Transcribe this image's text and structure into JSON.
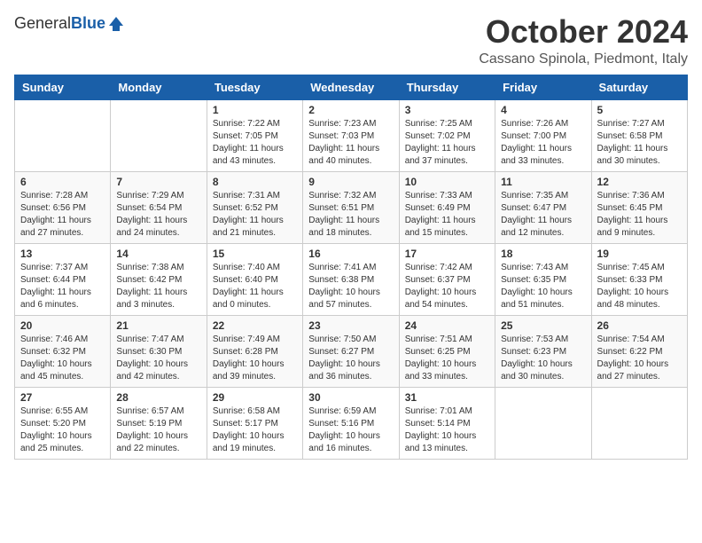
{
  "header": {
    "logo_general": "General",
    "logo_blue": "Blue",
    "month_title": "October 2024",
    "location": "Cassano Spinola, Piedmont, Italy"
  },
  "weekdays": [
    "Sunday",
    "Monday",
    "Tuesday",
    "Wednesday",
    "Thursday",
    "Friday",
    "Saturday"
  ],
  "weeks": [
    [
      {
        "day": "",
        "info": ""
      },
      {
        "day": "",
        "info": ""
      },
      {
        "day": "1",
        "info": "Sunrise: 7:22 AM\nSunset: 7:05 PM\nDaylight: 11 hours and 43 minutes."
      },
      {
        "day": "2",
        "info": "Sunrise: 7:23 AM\nSunset: 7:03 PM\nDaylight: 11 hours and 40 minutes."
      },
      {
        "day": "3",
        "info": "Sunrise: 7:25 AM\nSunset: 7:02 PM\nDaylight: 11 hours and 37 minutes."
      },
      {
        "day": "4",
        "info": "Sunrise: 7:26 AM\nSunset: 7:00 PM\nDaylight: 11 hours and 33 minutes."
      },
      {
        "day": "5",
        "info": "Sunrise: 7:27 AM\nSunset: 6:58 PM\nDaylight: 11 hours and 30 minutes."
      }
    ],
    [
      {
        "day": "6",
        "info": "Sunrise: 7:28 AM\nSunset: 6:56 PM\nDaylight: 11 hours and 27 minutes."
      },
      {
        "day": "7",
        "info": "Sunrise: 7:29 AM\nSunset: 6:54 PM\nDaylight: 11 hours and 24 minutes."
      },
      {
        "day": "8",
        "info": "Sunrise: 7:31 AM\nSunset: 6:52 PM\nDaylight: 11 hours and 21 minutes."
      },
      {
        "day": "9",
        "info": "Sunrise: 7:32 AM\nSunset: 6:51 PM\nDaylight: 11 hours and 18 minutes."
      },
      {
        "day": "10",
        "info": "Sunrise: 7:33 AM\nSunset: 6:49 PM\nDaylight: 11 hours and 15 minutes."
      },
      {
        "day": "11",
        "info": "Sunrise: 7:35 AM\nSunset: 6:47 PM\nDaylight: 11 hours and 12 minutes."
      },
      {
        "day": "12",
        "info": "Sunrise: 7:36 AM\nSunset: 6:45 PM\nDaylight: 11 hours and 9 minutes."
      }
    ],
    [
      {
        "day": "13",
        "info": "Sunrise: 7:37 AM\nSunset: 6:44 PM\nDaylight: 11 hours and 6 minutes."
      },
      {
        "day": "14",
        "info": "Sunrise: 7:38 AM\nSunset: 6:42 PM\nDaylight: 11 hours and 3 minutes."
      },
      {
        "day": "15",
        "info": "Sunrise: 7:40 AM\nSunset: 6:40 PM\nDaylight: 11 hours and 0 minutes."
      },
      {
        "day": "16",
        "info": "Sunrise: 7:41 AM\nSunset: 6:38 PM\nDaylight: 10 hours and 57 minutes."
      },
      {
        "day": "17",
        "info": "Sunrise: 7:42 AM\nSunset: 6:37 PM\nDaylight: 10 hours and 54 minutes."
      },
      {
        "day": "18",
        "info": "Sunrise: 7:43 AM\nSunset: 6:35 PM\nDaylight: 10 hours and 51 minutes."
      },
      {
        "day": "19",
        "info": "Sunrise: 7:45 AM\nSunset: 6:33 PM\nDaylight: 10 hours and 48 minutes."
      }
    ],
    [
      {
        "day": "20",
        "info": "Sunrise: 7:46 AM\nSunset: 6:32 PM\nDaylight: 10 hours and 45 minutes."
      },
      {
        "day": "21",
        "info": "Sunrise: 7:47 AM\nSunset: 6:30 PM\nDaylight: 10 hours and 42 minutes."
      },
      {
        "day": "22",
        "info": "Sunrise: 7:49 AM\nSunset: 6:28 PM\nDaylight: 10 hours and 39 minutes."
      },
      {
        "day": "23",
        "info": "Sunrise: 7:50 AM\nSunset: 6:27 PM\nDaylight: 10 hours and 36 minutes."
      },
      {
        "day": "24",
        "info": "Sunrise: 7:51 AM\nSunset: 6:25 PM\nDaylight: 10 hours and 33 minutes."
      },
      {
        "day": "25",
        "info": "Sunrise: 7:53 AM\nSunset: 6:23 PM\nDaylight: 10 hours and 30 minutes."
      },
      {
        "day": "26",
        "info": "Sunrise: 7:54 AM\nSunset: 6:22 PM\nDaylight: 10 hours and 27 minutes."
      }
    ],
    [
      {
        "day": "27",
        "info": "Sunrise: 6:55 AM\nSunset: 5:20 PM\nDaylight: 10 hours and 25 minutes."
      },
      {
        "day": "28",
        "info": "Sunrise: 6:57 AM\nSunset: 5:19 PM\nDaylight: 10 hours and 22 minutes."
      },
      {
        "day": "29",
        "info": "Sunrise: 6:58 AM\nSunset: 5:17 PM\nDaylight: 10 hours and 19 minutes."
      },
      {
        "day": "30",
        "info": "Sunrise: 6:59 AM\nSunset: 5:16 PM\nDaylight: 10 hours and 16 minutes."
      },
      {
        "day": "31",
        "info": "Sunrise: 7:01 AM\nSunset: 5:14 PM\nDaylight: 10 hours and 13 minutes."
      },
      {
        "day": "",
        "info": ""
      },
      {
        "day": "",
        "info": ""
      }
    ]
  ]
}
